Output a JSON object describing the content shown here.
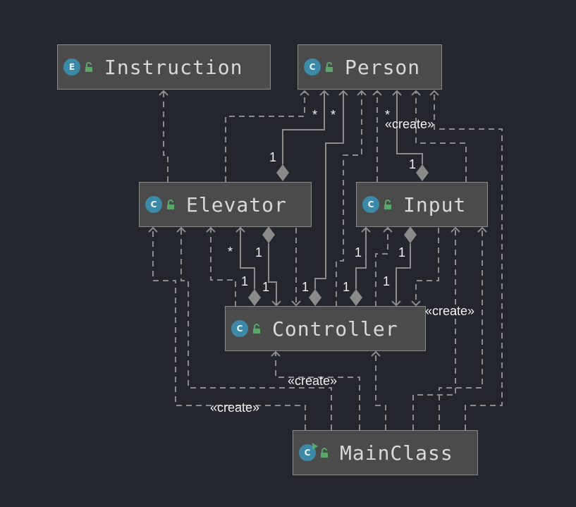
{
  "classes": [
    {
      "id": "instruction",
      "kind": "enum",
      "badge": "E",
      "name": "Instruction"
    },
    {
      "id": "person",
      "kind": "class",
      "badge": "C",
      "name": "Person"
    },
    {
      "id": "elevator",
      "kind": "class",
      "badge": "C",
      "name": "Elevator"
    },
    {
      "id": "input",
      "kind": "class",
      "badge": "C",
      "name": "Input"
    },
    {
      "id": "controller",
      "kind": "class",
      "badge": "C",
      "name": "Controller"
    },
    {
      "id": "mainclass",
      "kind": "main-class",
      "badge": "C",
      "name": "MainClass"
    }
  ],
  "edge_labels": {
    "star": "*",
    "one": "1",
    "create": "«create»"
  },
  "colors": {
    "background": "#23272d",
    "node_fill": "#4b4b4b",
    "node_border": "#8a8a8a",
    "edge": "#8c8c8c",
    "badge": "#3d8aa8",
    "lock": "#59a869",
    "text": "#d9d9d9"
  }
}
